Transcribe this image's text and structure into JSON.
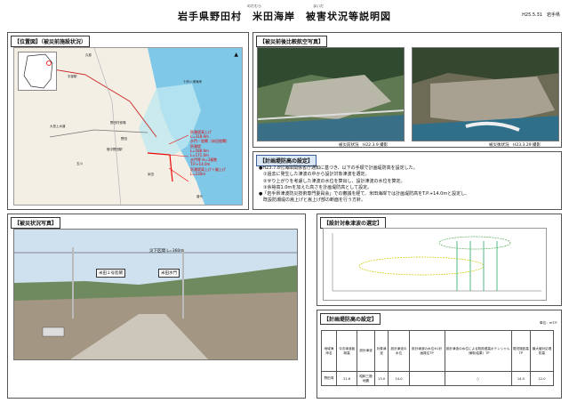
{
  "header": {
    "title": "岩手県野田村　米田海岸　被害状況等説明図",
    "ruby_noda": "のだむら",
    "ruby_yoneda": "まいだ",
    "date": "H25.5.31　岩手県"
  },
  "location": {
    "tag": "【位置図】（被災前施設状況）",
    "red_labels": [
      "防潮堤高上げ",
      "L=318.9m",
      "水門・陸閘（米田陸閘）",
      "防潮堤",
      "L=588.9m",
      "L=171.0m",
      "水門等 H=3基数",
      "T.P.+14.0m",
      "防潮堤高上げ＋嵩上げ",
      "L=230m"
    ],
    "map_labels": [
      "宇部駅",
      "野田村役場",
      "大島上水道",
      "久慈",
      "野田",
      "陸中野田駅",
      "玉川",
      "十府ヶ浦海岸",
      "米田",
      "普代"
    ]
  },
  "aerial": {
    "tag": "【被災前後比較航空写真】",
    "before_caption": "被災前状況　H22.3.9 撮影",
    "after_caption": "被災後状況　H23.3.29 撮影"
  },
  "plan": {
    "tag": "【計画堤防高の設定】",
    "lines": [
      "●H23.7.8付海岸関係省庁通知に基づき、以下の手順で計画堤防高を設定した。",
      "　①過去に発生した津波の中から設計対象津波を選定。",
      "　②せり上がりを考慮した津波の水位を算出し、設計津波の水位を算定。",
      "　③余裕高1.0mを加えた高さを計画堤防高として設定。",
      "●「岩手県津波防災技術専門委員会」での審議を経て、米田海岸では計画堤防高をT.P.+14.0mと設定し、",
      "　既設防潮堤の嵩上げと嵩上げ部の断面を行う方針。"
    ]
  },
  "damage": {
    "tag": "【被災状況写真】",
    "span_label": "災下区間  L=360m",
    "label_a": "米田２号陸閘",
    "label_b": "米田水門"
  },
  "tsunami": {
    "tag": "【設計対象津波の選定】"
  },
  "height_table": {
    "tag": "【計画堤防高の設定】",
    "unit": "単位：ｍT.P.",
    "headers": [
      "地域海岸名",
      "今次津波痕跡高",
      "設計津波",
      "対象津波",
      "設計津波の水位",
      "設計津波の水位※1計画既往TP",
      "設計津波の水位による既設堤高ポテンシャル（解析結果）TP",
      "現況施設高TP",
      "最大値対応堤防高"
    ],
    "row": [
      "野田湾",
      "21.6",
      "昭和三陸地震",
      "13.0",
      "14.0",
      "○",
      "14.0",
      "12.0"
    ]
  }
}
